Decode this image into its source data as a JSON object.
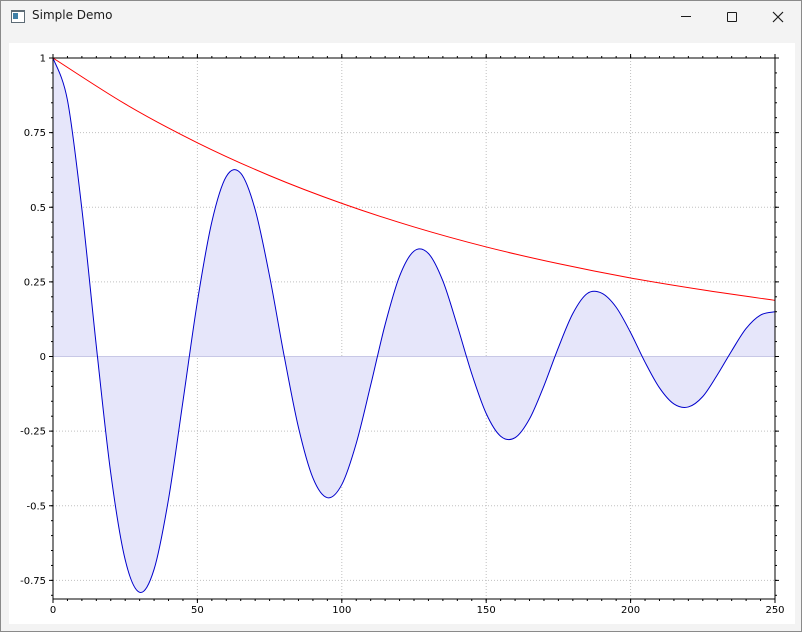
{
  "window": {
    "title": "Simple Demo",
    "icon": "app-window-icon",
    "controls": [
      "minimize-icon",
      "maximize-icon",
      "close-icon"
    ]
  },
  "chart_data": {
    "type": "line",
    "title": "",
    "xlabel": "",
    "ylabel": "",
    "xlim": [
      0,
      250
    ],
    "ylim": [
      -0.8,
      1
    ],
    "xticks": [
      0,
      50,
      100,
      150,
      200,
      250
    ],
    "xtick_labels": [
      "0",
      "50",
      "100",
      "150",
      "200",
      "250"
    ],
    "yticks": [
      1,
      0.75,
      0.5,
      0.25,
      0,
      -0.25,
      -0.5,
      -0.75
    ],
    "ytick_labels": [
      "1",
      "0.75",
      "0.5",
      "0.25",
      "0",
      "-0.25",
      "-0.5",
      "-0.75"
    ],
    "grid": true,
    "colors": {
      "wave": "#0000cc",
      "envelope": "#ff0000",
      "fill": "#e6e6fa",
      "grid": "#c0c0c0"
    },
    "series": [
      {
        "kind": "filled-line",
        "color": "#0000cc",
        "x": [
          0,
          5,
          10,
          15,
          20,
          25,
          30,
          35,
          40,
          45,
          50,
          55,
          60,
          65,
          70,
          75,
          80,
          85,
          90,
          95,
          100,
          105,
          110,
          115,
          120,
          125,
          130,
          135,
          140,
          145,
          150,
          155,
          160,
          165,
          170,
          175,
          180,
          185,
          190,
          195,
          200,
          205,
          210,
          215,
          220,
          225,
          230,
          235,
          240,
          245,
          250
        ],
        "y": [
          1.0,
          0.859,
          0.494,
          0.035,
          -0.391,
          -0.681,
          -0.79,
          -0.713,
          -0.478,
          -0.15,
          0.184,
          0.451,
          0.603,
          0.614,
          0.492,
          0.269,
          0.004,
          -0.238,
          -0.407,
          -0.473,
          -0.429,
          -0.291,
          -0.096,
          0.107,
          0.269,
          0.353,
          0.345,
          0.253,
          0.103,
          -0.058,
          -0.191,
          -0.267,
          -0.272,
          -0.209,
          -0.098,
          0.03,
          0.144,
          0.211,
          0.212,
          0.165,
          0.08,
          -0.019,
          -0.105,
          -0.159,
          -0.169,
          -0.134,
          -0.062,
          0.019,
          0.094,
          0.139,
          0.15
        ]
      },
      {
        "kind": "line",
        "color": "#ff0000",
        "x": [
          0,
          25,
          50,
          75,
          100,
          125,
          150,
          175,
          200,
          225,
          250
        ],
        "y": [
          1.0,
          0.846,
          0.716,
          0.606,
          0.513,
          0.434,
          0.367,
          0.311,
          0.263,
          0.223,
          0.188
        ]
      }
    ]
  }
}
